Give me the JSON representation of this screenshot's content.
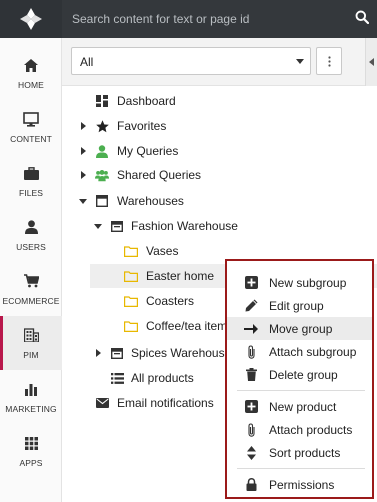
{
  "search": {
    "placeholder": "Search content for text or page id"
  },
  "rail": {
    "items": [
      {
        "label": "HOME",
        "icon": "home-icon"
      },
      {
        "label": "CONTENT",
        "icon": "monitor-icon"
      },
      {
        "label": "FILES",
        "icon": "briefcase-icon"
      },
      {
        "label": "USERS",
        "icon": "user-icon"
      },
      {
        "label": "ECOMMERCE",
        "icon": "cart-icon"
      },
      {
        "label": "PIM",
        "icon": "building-icon",
        "active": true
      },
      {
        "label": "MARKETING",
        "icon": "bar-chart-icon"
      },
      {
        "label": "APPS",
        "icon": "grid-icon"
      }
    ]
  },
  "filter": {
    "selected": "All"
  },
  "tree": {
    "dashboard": "Dashboard",
    "favorites": "Favorites",
    "my_queries": "My Queries",
    "shared_queries": "Shared Queries",
    "warehouses": "Warehouses",
    "fashion_warehouse": "Fashion Warehouse",
    "vases": "Vases",
    "easter_home": "Easter home",
    "coasters": "Coasters",
    "coffee_tea": "Coffee/tea items",
    "spices_warehouse": "Spices Warehouse",
    "all_products": "All products",
    "email_notifications": "Email notifications"
  },
  "context_menu": {
    "new_subgroup": "New subgroup",
    "edit_group": "Edit group",
    "move_group": "Move group",
    "attach_subgroup": "Attach subgroup",
    "delete_group": "Delete group",
    "new_product": "New product",
    "attach_products": "Attach products",
    "sort_products": "Sort products",
    "permissions": "Permissions"
  },
  "colors": {
    "topbar": "#34383c",
    "accent_pim": "#b8174b",
    "menu_border": "#9b1a1a",
    "queries_green": "#4caf50",
    "folder_yellow": "#e8b800"
  }
}
